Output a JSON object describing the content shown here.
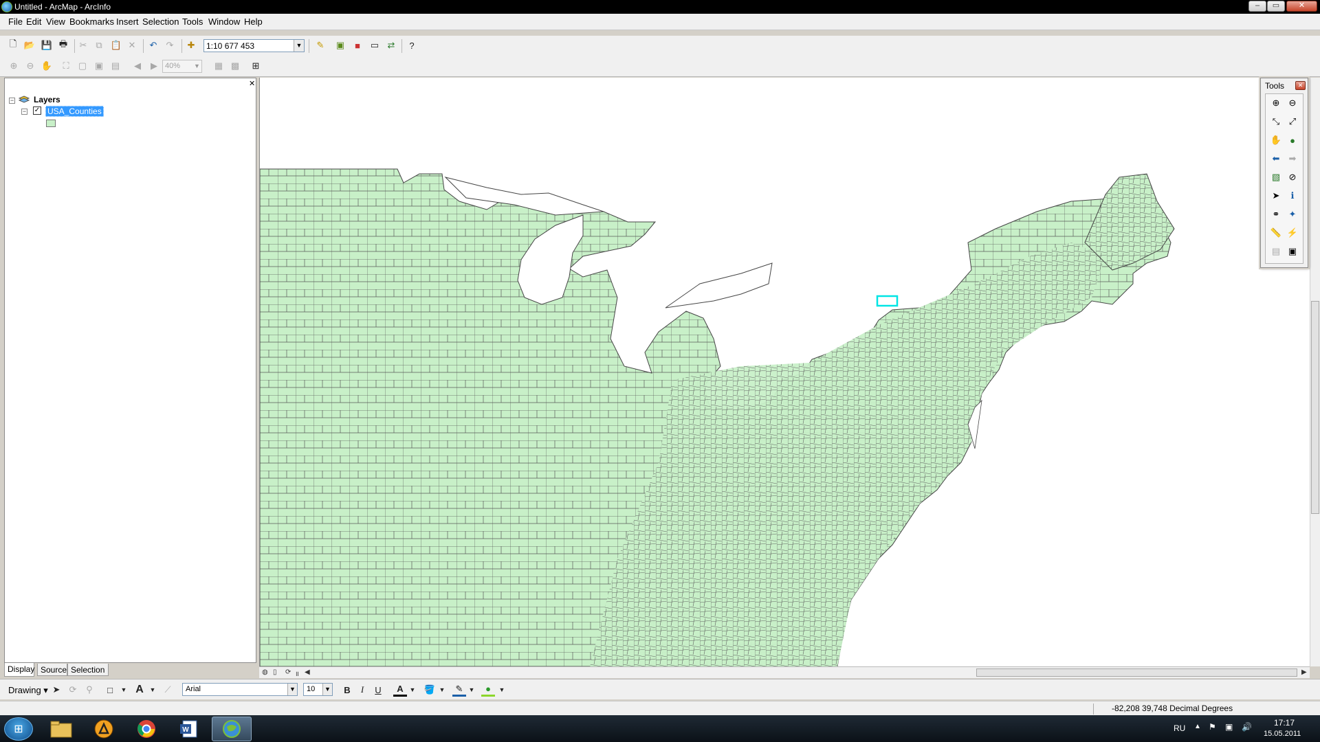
{
  "window": {
    "title": "Untitled - ArcMap - ArcInfo"
  },
  "menu": [
    {
      "label": "File"
    },
    {
      "label": "Edit"
    },
    {
      "label": "View"
    },
    {
      "label": "Bookmarks"
    },
    {
      "label": "Insert"
    },
    {
      "label": "Selection"
    },
    {
      "label": "Tools"
    },
    {
      "label": "Window"
    },
    {
      "label": "Help"
    }
  ],
  "toolbar": {
    "scale": "1:10 677 453",
    "zoom_percent": "40%"
  },
  "toc": {
    "root_label": "Layers",
    "layer_name": "USA_Counties",
    "layer_visible": true,
    "tabs": [
      {
        "label": "Display"
      },
      {
        "label": "Source"
      },
      {
        "label": "Selection"
      }
    ],
    "active_tab": "Display"
  },
  "map": {
    "fill_color": "#c8f0c8",
    "outline_color": "#4a4a4a",
    "highlight_color": "#00e5e5"
  },
  "tools_panel": {
    "title": "Tools"
  },
  "drawing": {
    "label": "Drawing",
    "font_name": "Arial",
    "font_size": "10",
    "bold": "B",
    "italic": "I",
    "underline": "U",
    "text_tool": "A"
  },
  "status": {
    "coordinates": "-82,208  39,748 Decimal Degrees"
  },
  "taskbar": {
    "language": "RU",
    "time": "17:17",
    "date": "15.05.2011"
  }
}
